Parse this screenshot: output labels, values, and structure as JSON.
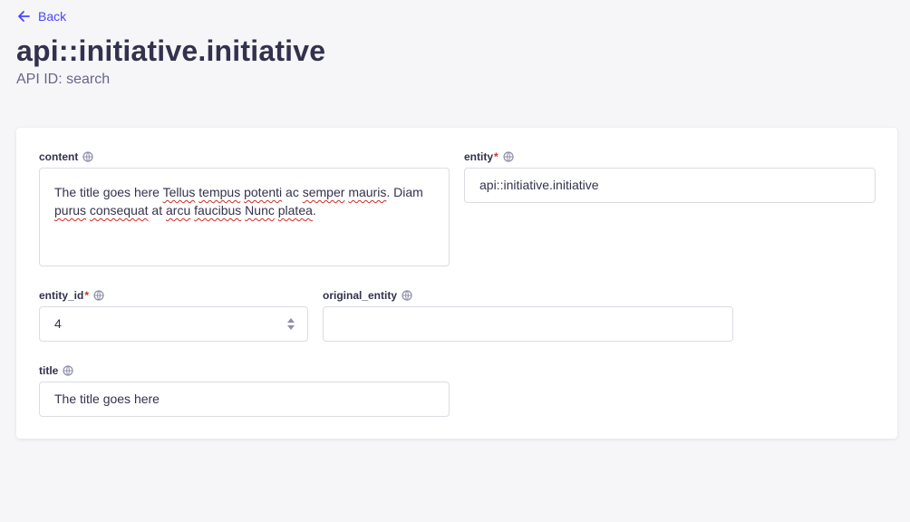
{
  "header": {
    "back_label": "Back",
    "title": "api::initiative.initiative",
    "subtitle": "API ID: search"
  },
  "form": {
    "content": {
      "label": "content",
      "value_parts": [
        {
          "text": "The title goes here ",
          "misspelled": false
        },
        {
          "text": "Tellus",
          "misspelled": true
        },
        {
          "text": " ",
          "misspelled": false
        },
        {
          "text": "tempus",
          "misspelled": true
        },
        {
          "text": " ",
          "misspelled": false
        },
        {
          "text": "potenti",
          "misspelled": true
        },
        {
          "text": " ac ",
          "misspelled": false
        },
        {
          "text": "semper",
          "misspelled": true
        },
        {
          "text": " ",
          "misspelled": false
        },
        {
          "text": "mauris",
          "misspelled": true
        },
        {
          "text": ". Diam ",
          "misspelled": false
        },
        {
          "text": "purus",
          "misspelled": true
        },
        {
          "text": " ",
          "misspelled": false
        },
        {
          "text": "consequat",
          "misspelled": true
        },
        {
          "text": " at ",
          "misspelled": false
        },
        {
          "text": "arcu",
          "misspelled": true
        },
        {
          "text": " ",
          "misspelled": false
        },
        {
          "text": "faucibus",
          "misspelled": true
        },
        {
          "text": " ",
          "misspelled": false
        },
        {
          "text": "Nunc",
          "misspelled": true
        },
        {
          "text": " ",
          "misspelled": false
        },
        {
          "text": "platea",
          "misspelled": true
        },
        {
          "text": ".",
          "misspelled": false
        }
      ]
    },
    "entity": {
      "label": "entity",
      "required_mark": "*",
      "value": "api::initiative.initiative"
    },
    "entity_id": {
      "label": "entity_id",
      "required_mark": "*",
      "value": "4"
    },
    "original_entity": {
      "label": "original_entity",
      "value": ""
    },
    "title": {
      "label": "title",
      "value": "The title goes here"
    }
  },
  "colors": {
    "accent": "#4945ff",
    "required": "#d02b20",
    "text": "#32324d",
    "muted": "#666687",
    "border": "#dcdce4",
    "background": "#f6f6f9"
  },
  "icons": {
    "back": "arrow-left-icon",
    "localized": "globe-icon",
    "stepper": "chevron-up-down-icon"
  }
}
